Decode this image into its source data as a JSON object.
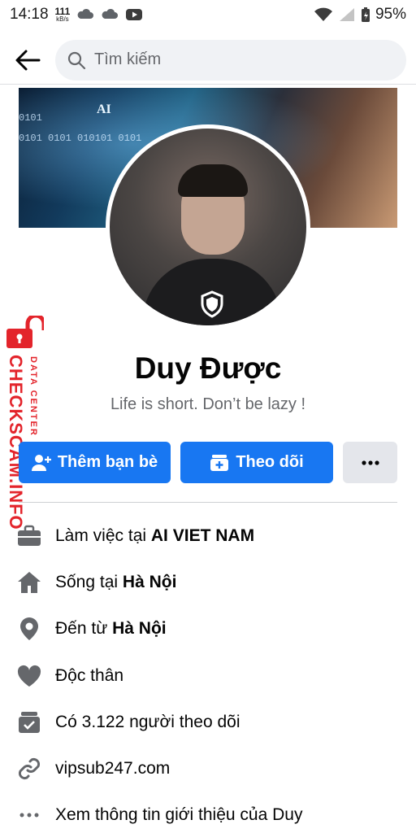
{
  "status_bar": {
    "time": "14:18",
    "speed_value": "111",
    "speed_unit": "kB/s",
    "battery": "95%"
  },
  "search": {
    "placeholder": "Tìm kiếm"
  },
  "cover": {
    "binary_text_1": "0101 0101 010101 0101",
    "binary_text_2": "0101",
    "ai_label": "AI"
  },
  "profile": {
    "name": "Duy Được",
    "bio": "Life is short. Don’t be lazy !"
  },
  "watermark": {
    "main": "CHECKSCAM.INFO",
    "sub": "DATA CENTER"
  },
  "actions": {
    "add_friend": "Thêm bạn bè",
    "follow": "Theo dõi"
  },
  "info": [
    {
      "icon": "briefcase-icon",
      "prefix": "Làm việc tại ",
      "bold": "AI VIET NAM"
    },
    {
      "icon": "home-icon",
      "prefix": "Sống tại ",
      "bold": "Hà Nội"
    },
    {
      "icon": "location-pin-icon",
      "prefix": "Đến từ ",
      "bold": "Hà Nội"
    },
    {
      "icon": "heart-icon",
      "prefix": "Độc thân",
      "bold": ""
    },
    {
      "icon": "followers-icon",
      "prefix": "Có 3.122 người theo dõi",
      "bold": ""
    },
    {
      "icon": "link-icon",
      "prefix": "vipsub247.com",
      "bold": ""
    },
    {
      "icon": "more-dots-icon",
      "prefix": "Xem thông tin giới thiệu của Duy",
      "bold": ""
    }
  ],
  "colors": {
    "primary": "#1877f2",
    "secondary_button": "#e4e6eb",
    "watermark": "#e3242b"
  }
}
